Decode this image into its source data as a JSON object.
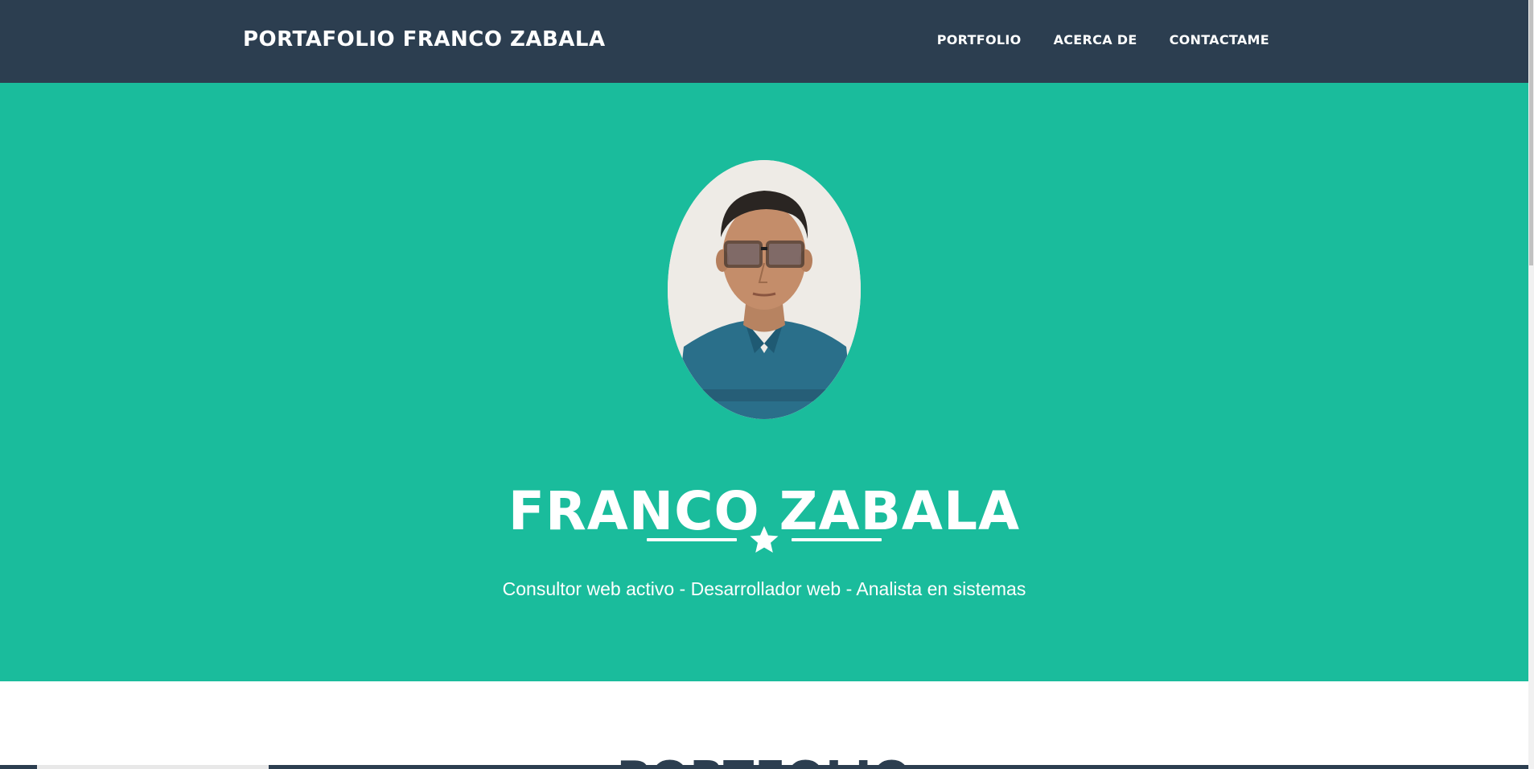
{
  "navbar": {
    "brand": "PORTAFOLIO FRANCO ZABALA",
    "links": [
      {
        "label": "PORTFOLIO"
      },
      {
        "label": "ACERCA DE"
      },
      {
        "label": "CONTACTAME"
      }
    ]
  },
  "hero": {
    "avatar_icon": "profile-photo",
    "name": "FRANCO ZABALA",
    "divider_icon": "star-icon",
    "subtitle": "Consultor web activo - Desarrollador web - Analista en sistemas"
  },
  "portfolio": {
    "heading": "PORTFOLIO"
  },
  "colors": {
    "navbar_bg": "#2c3e50",
    "hero_bg": "#1abc9c",
    "text_light": "#ffffff",
    "heading_dark": "#2c3e50"
  }
}
